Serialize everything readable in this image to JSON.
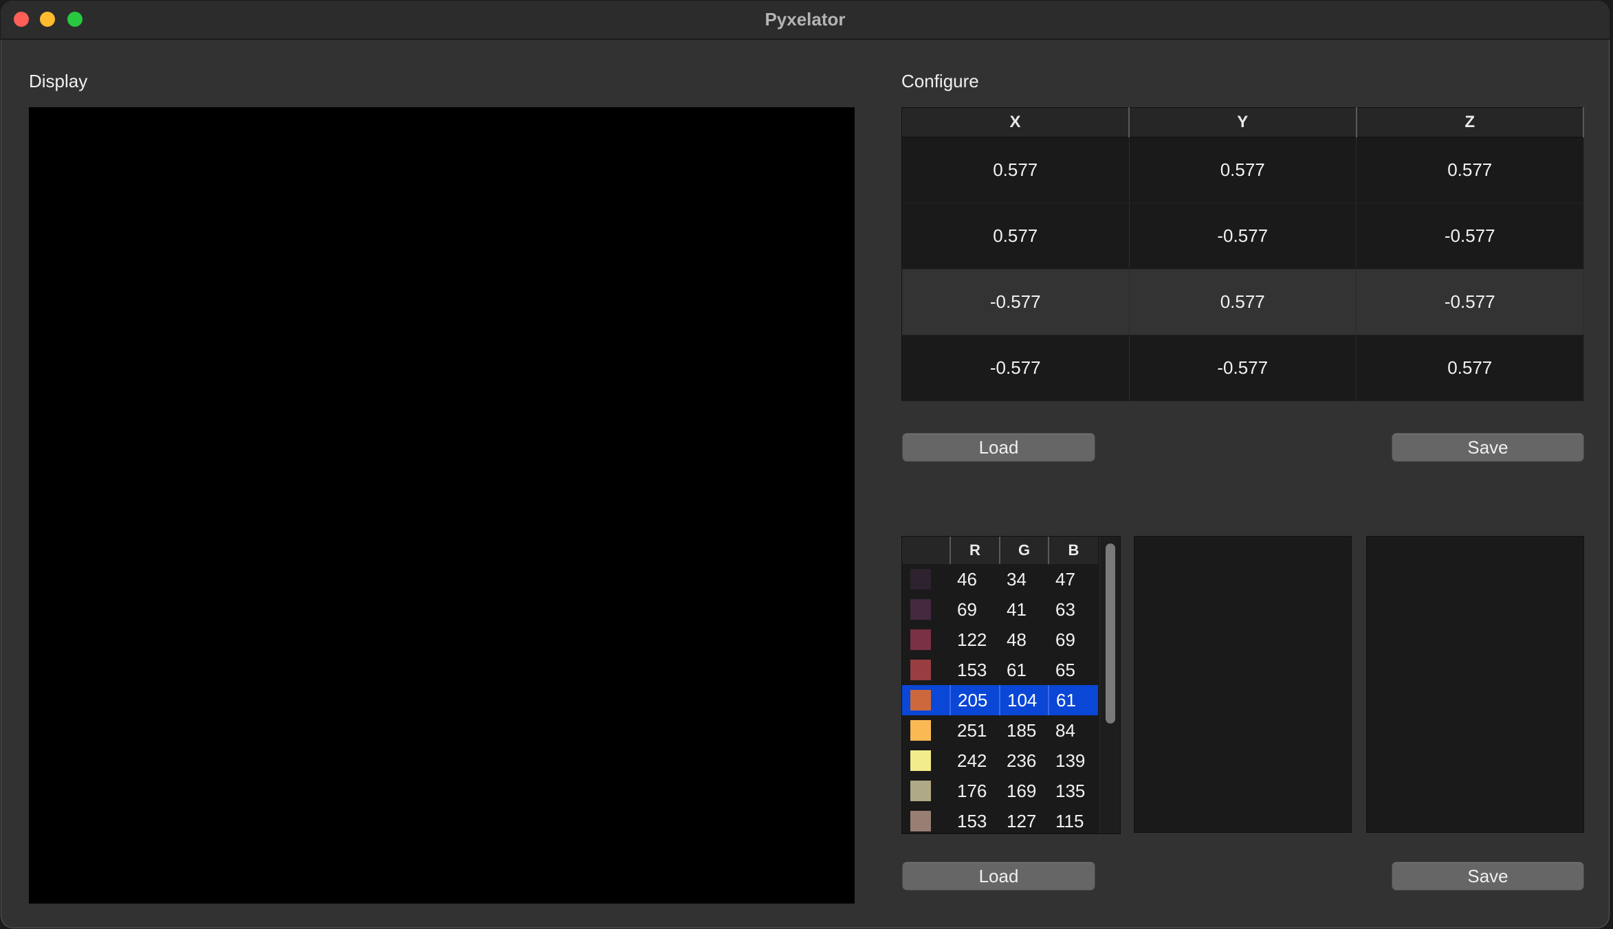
{
  "window": {
    "title": "Pyxelator",
    "controls": {
      "close_color": "#ff5f57",
      "minimize_color": "#febc2e",
      "zoom_color": "#28c840"
    }
  },
  "display": {
    "label": "Display"
  },
  "configure": {
    "label": "Configure",
    "columns": [
      "X",
      "Y",
      "Z"
    ],
    "rows": [
      [
        "0.577",
        "0.577",
        "0.577"
      ],
      [
        "0.577",
        "-0.577",
        "-0.577"
      ],
      [
        "-0.577",
        "0.577",
        "-0.577"
      ],
      [
        "-0.577",
        "-0.577",
        "0.577"
      ]
    ],
    "load_label": "Load",
    "save_label": "Save"
  },
  "palette": {
    "columns": [
      "",
      "R",
      "G",
      "B"
    ],
    "selected_index": 4,
    "rows": [
      {
        "r": "46",
        "g": "34",
        "b": "47",
        "color": "#2e222f"
      },
      {
        "r": "69",
        "g": "41",
        "b": "63",
        "color": "#45293f"
      },
      {
        "r": "122",
        "g": "48",
        "b": "69",
        "color": "#7a3045"
      },
      {
        "r": "153",
        "g": "61",
        "b": "65",
        "color": "#993d41"
      },
      {
        "r": "205",
        "g": "104",
        "b": "61",
        "color": "#cd683d"
      },
      {
        "r": "251",
        "g": "185",
        "b": "84",
        "color": "#fbb954"
      },
      {
        "r": "242",
        "g": "236",
        "b": "139",
        "color": "#f2ec8b"
      },
      {
        "r": "176",
        "g": "169",
        "b": "135",
        "color": "#b0a987"
      },
      {
        "r": "153",
        "g": "127",
        "b": "115",
        "color": "#997f73"
      }
    ],
    "load_label": "Load",
    "save_label": "Save"
  }
}
